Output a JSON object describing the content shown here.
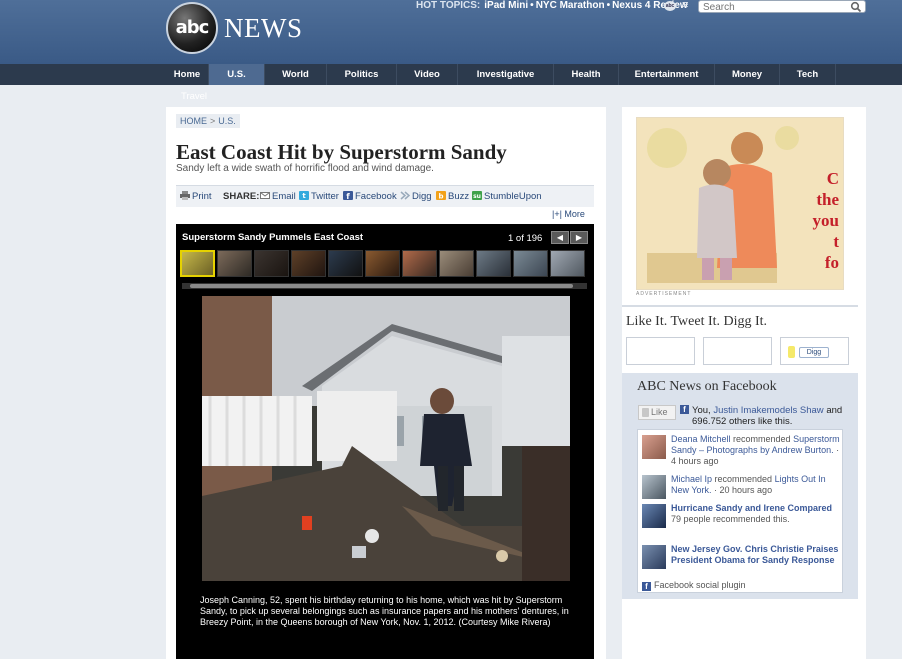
{
  "header": {
    "logo_ball_text": "abc",
    "logo_news_text": "NEWS",
    "hot_topics_label": "HOT TOPICS:",
    "hot_topics": [
      "iPad Mini",
      "NYC Marathon",
      "Nexus 4 Review"
    ],
    "search_placeholder": "Search"
  },
  "nav": {
    "items": [
      "Home",
      "U.S.",
      "World",
      "Politics",
      "Video",
      "Investigative",
      "Health",
      "Entertainment",
      "Money",
      "Tech"
    ],
    "active": "U.S.",
    "subnav": "Travel"
  },
  "breadcrumb": {
    "home": "HOME",
    "sep": ">",
    "section": "U.S."
  },
  "article": {
    "title": "East Coast Hit by Superstorm Sandy",
    "subtitle": "Sandy left a wide swath of horrific flood and wind damage."
  },
  "share": {
    "print": "Print",
    "label": "SHARE:",
    "email": "Email",
    "twitter": "Twitter",
    "facebook": "Facebook",
    "digg": "Digg",
    "buzz": "Buzz",
    "stumbleupon": "StumbleUpon",
    "more": "|+| More"
  },
  "gallery": {
    "title": "Superstorm Sandy Pummels East Coast",
    "count": "1 of 196",
    "prev": "◀",
    "next": "▶",
    "caption": "Joseph Canning, 52, spent his birthday returning to his home, which was hit by Superstorm Sandy, to pick up several belongings such as insurance papers and his mothers' dentures, in Breezy Point, in the Queens borough of New York, Nov. 1, 2012. (Courtesy Mike Rivera)"
  },
  "ad": {
    "text_lines": [
      "C",
      "the",
      "you",
      "t",
      "fo"
    ],
    "label": "ADVERTISEMENT"
  },
  "social": {
    "title": "Like It. Tweet It. Digg It.",
    "digg_button": "Digg"
  },
  "facebook": {
    "title": "ABC News on Facebook",
    "like_button": "Like",
    "you": "You,",
    "friend": "Justin Imakemodels Shaw",
    "and": "and",
    "others": "696,752 others like this.",
    "items": [
      {
        "name": "Deana Mitchell",
        "action": " recommended ",
        "link": "Superstorm Sandy – Photographs by Andrew Burton.",
        "time": " · 4 hours ago"
      },
      {
        "name": "Michael Ip",
        "action": " recommended ",
        "link": "Lights Out In New York.",
        "time": " · 20 hours ago"
      },
      {
        "title": "Hurricane Sandy and Irene Compared",
        "meta": "79 people recommended this."
      },
      {
        "title": "New Jersey Gov. Chris Christie Praises President Obama for Sandy Response"
      }
    ],
    "plugin": "Facebook social plugin"
  }
}
